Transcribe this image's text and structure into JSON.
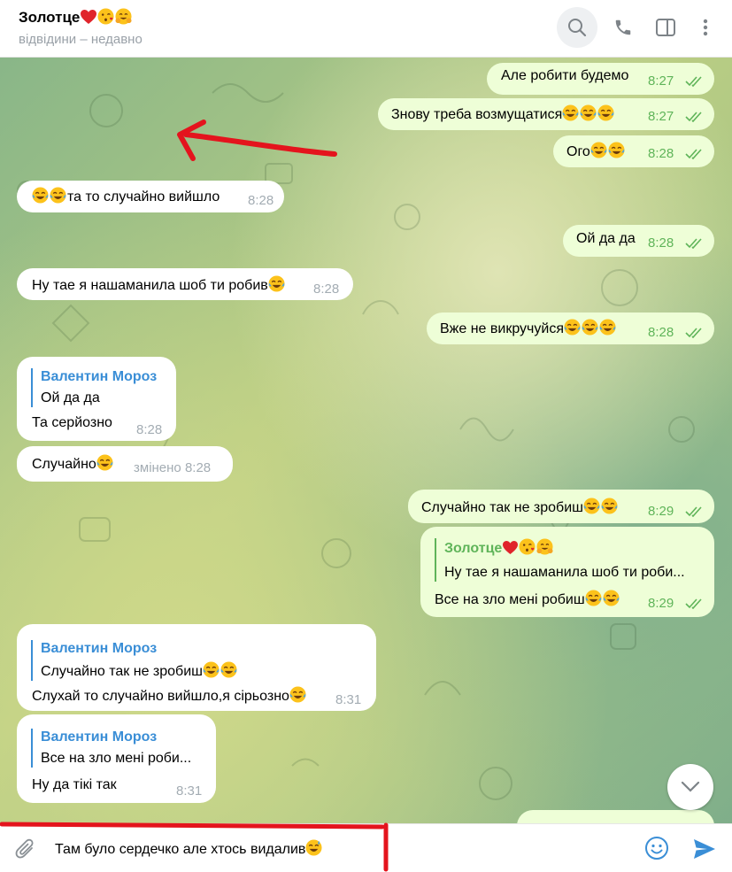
{
  "header": {
    "title": "Золотце",
    "title_emojis": [
      "red-heart",
      "face-blowing-kiss",
      "hugging-face"
    ],
    "subtitle": "відвідини – недавно",
    "icons": [
      "search-icon",
      "phone-icon",
      "sidebar-toggle-icon",
      "more-vertical-icon"
    ]
  },
  "messages": [
    {
      "dir": "out",
      "text": "Але робити будемо",
      "time": "8:27",
      "read": true
    },
    {
      "dir": "out",
      "text": "Знову треба возмущатися",
      "emoji_count": 3,
      "time": "8:27",
      "read": true
    },
    {
      "dir": "out",
      "text": "Ого",
      "emoji_count": 2,
      "time": "8:28",
      "read": true
    },
    {
      "dir": "in",
      "leading_emoji_count": 2,
      "text": "та то случайно вийшло",
      "time": "8:28"
    },
    {
      "dir": "out",
      "text": "Ой да да",
      "time": "8:28",
      "read": true
    },
    {
      "dir": "in",
      "text": "Ну тае я нашаманила шоб ти робив",
      "emoji_count": 1,
      "time": "8:28"
    },
    {
      "dir": "out",
      "text": "Вже не викручуйся",
      "emoji_count": 3,
      "time": "8:28",
      "read": true
    },
    {
      "dir": "in",
      "reply_to": {
        "name": "Валентин Мороз",
        "text": "Ой да да"
      },
      "text": "Та серйозно",
      "time": "8:28"
    },
    {
      "dir": "in",
      "text": "Случайно",
      "emoji_count": 1,
      "edited_label": "змінено",
      "time": "8:28"
    },
    {
      "dir": "out",
      "text": "Случайно так не зробиш",
      "emoji_count": 2,
      "time": "8:29",
      "read": true
    },
    {
      "dir": "out",
      "reply_to": {
        "name": "Золотце",
        "text": "Ну тае я нашаманила шоб ти роби..."
      },
      "text": "Все на зло мені робиш",
      "emoji_count": 2,
      "time": "8:29",
      "read": true
    },
    {
      "dir": "in",
      "reply_to": {
        "name": "Валентин Мороз",
        "text": "Случайно так не зробиш",
        "emoji_count": 2
      },
      "text": "Слухай то случайно вийшло,я сірьозно",
      "emoji_count": 1,
      "time": "8:31"
    },
    {
      "dir": "in",
      "reply_to": {
        "name": "Валентин Мороз",
        "text": "Все на зло мені роби..."
      },
      "text": "Ну да тікі так",
      "time": "8:31"
    }
  ],
  "composer": {
    "text": "Там було сердечко але хтось видалив",
    "emoji_count": 1,
    "icons": [
      "attach-icon",
      "emoji-icon",
      "send-icon"
    ]
  },
  "colors": {
    "outgoing_bubble": "#eefed7",
    "incoming_bubble": "#ffffff",
    "reply_name_in": "#3a8ed6",
    "reply_name_out": "#5fb459",
    "annotation": "#e4141d"
  }
}
